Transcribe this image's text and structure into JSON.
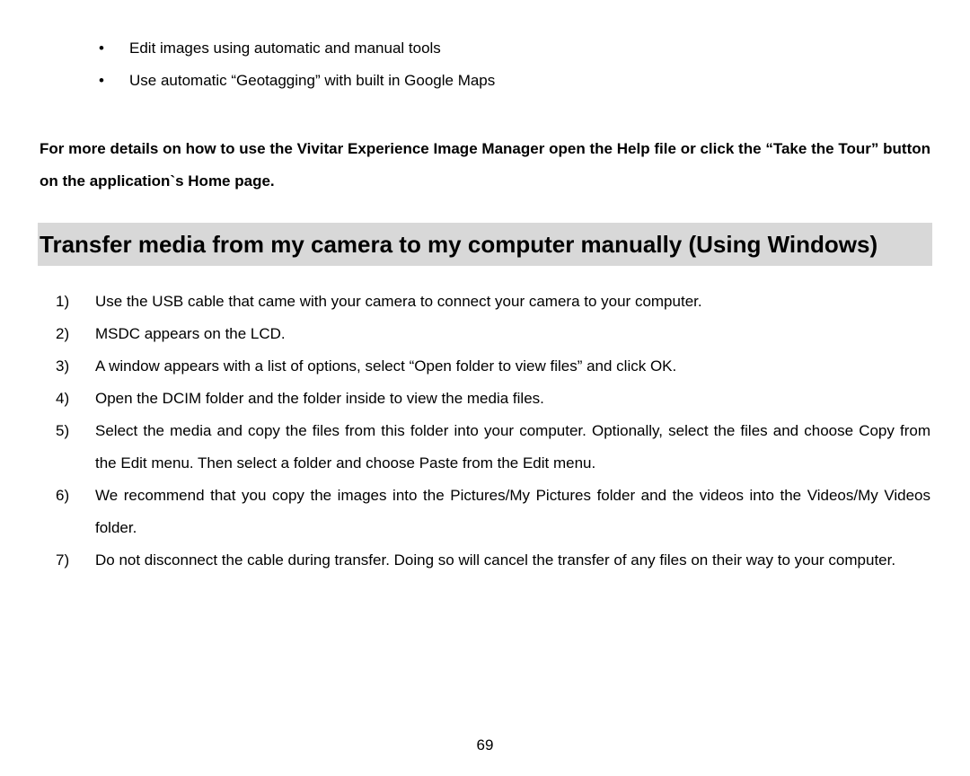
{
  "bullets": [
    "Edit images using automatic and manual tools",
    "Use automatic “Geotagging” with built in Google Maps"
  ],
  "details_line": "For more details on how to use the Vivitar Experience Image Manager open the Help file or click the “Take the Tour” button on the application`s Home page.",
  "section_heading": "Transfer media from my camera to my computer manually (Using Windows)",
  "steps": [
    "Use the USB cable that came with your camera to connect your camera to your computer.",
    "MSDC appears on the LCD.",
    "A window appears with a list of options, select “Open folder to view files” and click OK.",
    "Open the DCIM folder and the folder inside to view the media files.",
    "Select the media and copy the files from this folder into your computer. Optionally, select the files and choose Copy from the Edit menu. Then select a folder and choose Paste from the Edit menu.",
    "We recommend that you copy the images into the Pictures/My Pictures folder and the videos into the Videos/My Videos folder.",
    "Do not disconnect the cable during transfer. Doing so will cancel the transfer of any files on their way to your computer."
  ],
  "page_number": "69"
}
